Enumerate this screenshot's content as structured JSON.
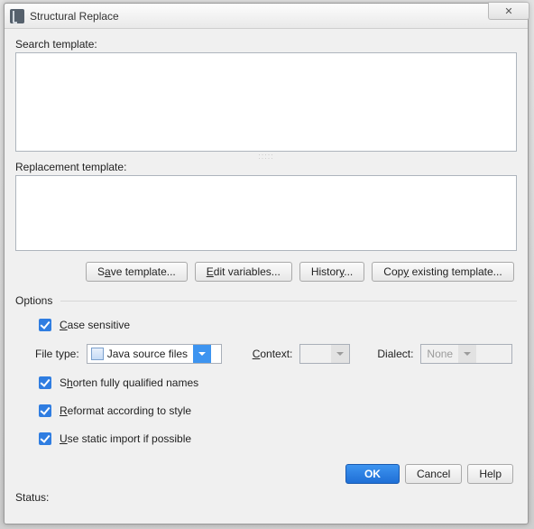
{
  "window": {
    "title": "Structural Replace",
    "close_glyph": "✕"
  },
  "labels": {
    "search_template": "Search template:",
    "replacement_template": "Replacement template:",
    "options": "Options",
    "file_type": "File type:",
    "context": "Context:",
    "dialect": "Dialect:",
    "status": "Status:"
  },
  "fields": {
    "search_value": "",
    "replace_value": "",
    "file_type_value": "Java source files",
    "context_value": "",
    "dialect_value": "None"
  },
  "toolbar": {
    "save_pre": "S",
    "save_mn": "a",
    "save_post": "ve template...",
    "edit_mn": "E",
    "edit_post": "dit variables...",
    "hist_pre": "Histor",
    "hist_mn": "y",
    "hist_post": "...",
    "copy_pre": "Cop",
    "copy_mn": "y",
    "copy_post": " existing template..."
  },
  "options": {
    "case_mn": "C",
    "case_post": "ase sensitive",
    "shorten_pre": "S",
    "shorten_mn": "h",
    "shorten_post": "orten fully qualified names",
    "reformat_mn": "R",
    "reformat_post": "eformat according to style",
    "static_mn": "U",
    "static_post": "se static import if possible"
  },
  "footer": {
    "ok": "OK",
    "cancel": "Cancel",
    "help": "Help"
  },
  "checks": {
    "case": true,
    "shorten": true,
    "reformat": true,
    "static": true
  }
}
